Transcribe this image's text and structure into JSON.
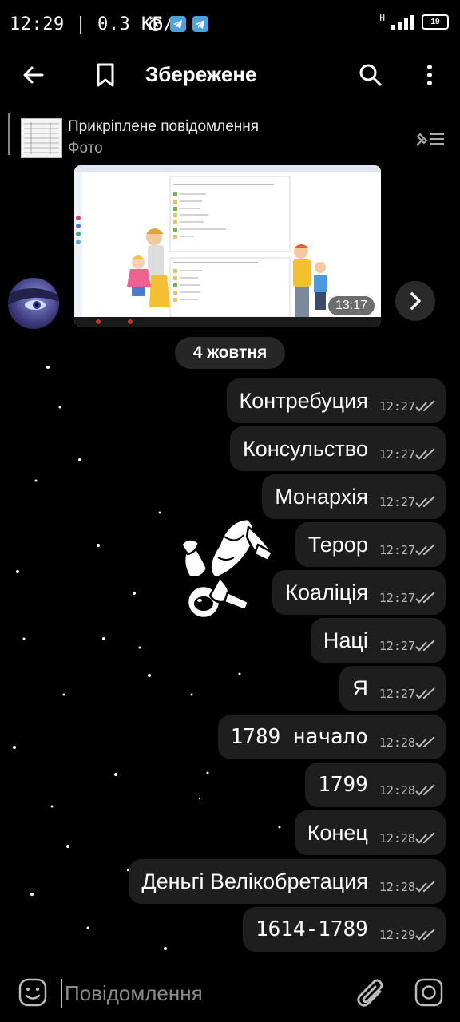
{
  "status_bar": {
    "time": "12:29",
    "speed": "| 0.3 КБ/с",
    "network": "H",
    "battery": "19"
  },
  "header": {
    "title": "Збережене"
  },
  "pinned": {
    "title": "Прикріплене повідомлення",
    "subtitle": "Фото"
  },
  "photo_message": {
    "time": "13:17"
  },
  "date_separator": "4 жовтня",
  "messages": [
    {
      "text": "Контребуция",
      "time": "12:27"
    },
    {
      "text": "Консульство",
      "time": "12:27"
    },
    {
      "text": "Монархія",
      "time": "12:27"
    },
    {
      "text": "Терор",
      "time": "12:27"
    },
    {
      "text": "Коаліція",
      "time": "12:27"
    },
    {
      "text": "Наці",
      "time": "12:27"
    },
    {
      "text": "Я",
      "time": "12:27"
    },
    {
      "text": "1789  начало",
      "time": "12:28"
    },
    {
      "text": "1799",
      "time": "12:28"
    },
    {
      "text": "Конец",
      "time": "12:28"
    },
    {
      "text": "Деньгі  Велікобретация",
      "time": "12:28"
    },
    {
      "text": "1614-1789",
      "time": "12:29"
    }
  ],
  "input": {
    "placeholder": "Повідомлення"
  },
  "icons": {
    "back": "arrow-left-icon",
    "bookmark": "bookmark-icon",
    "search": "search-icon",
    "menu": "more-vertical-icon",
    "unpin": "unpin-icon",
    "forward": "chevron-right-icon",
    "emoji": "emoji-icon",
    "attach": "paperclip-icon",
    "camera": "instagram-camera-icon"
  },
  "colors": {
    "background": "#000000",
    "bubble": "#1e1e1e",
    "meta": "#bbbbbb"
  }
}
